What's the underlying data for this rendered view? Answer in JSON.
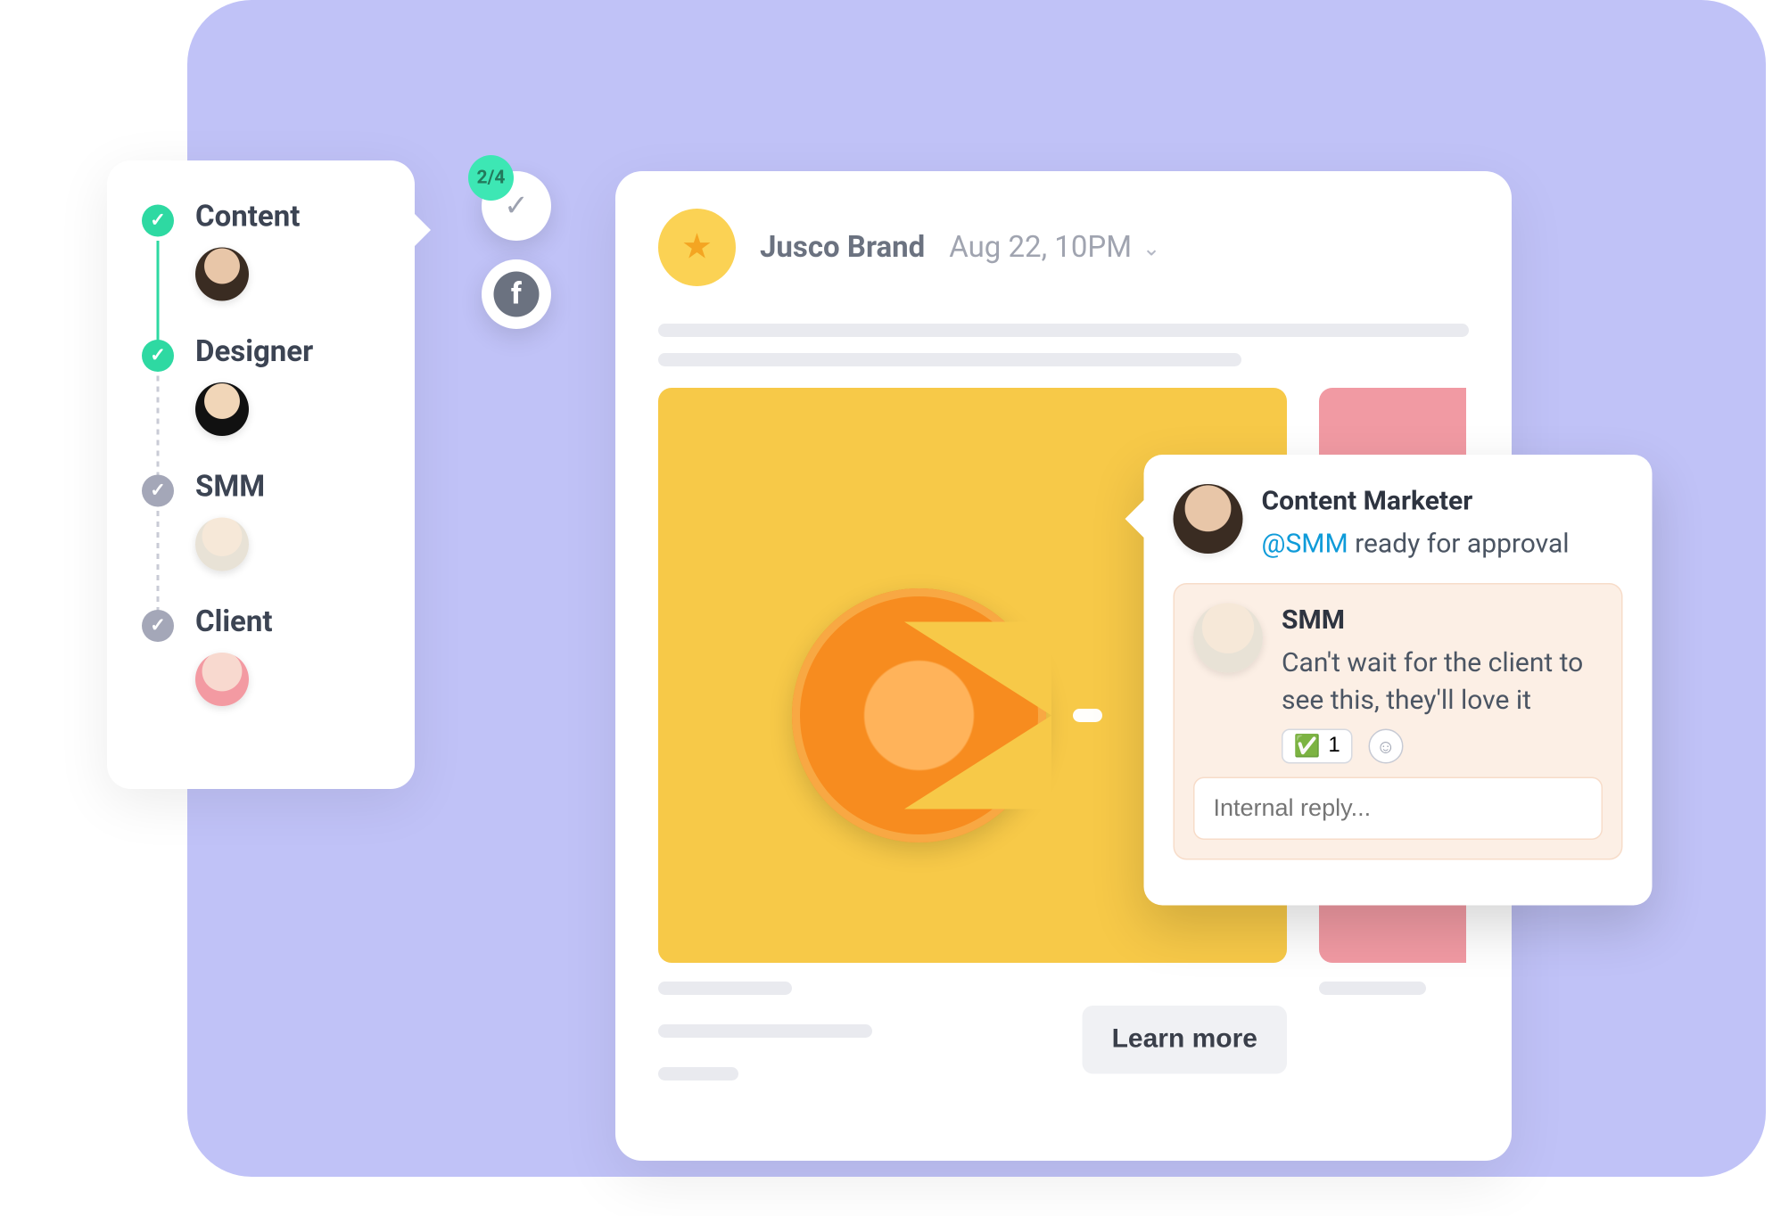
{
  "workflow": {
    "steps": [
      {
        "label": "Content",
        "done": true
      },
      {
        "label": "Designer",
        "done": true
      },
      {
        "label": "SMM",
        "done": false
      },
      {
        "label": "Client",
        "done": false
      }
    ]
  },
  "status": {
    "approval_count": "2/4",
    "platform": "facebook"
  },
  "post": {
    "brand": "Jusco Brand",
    "timestamp": "Aug 22, 10PM",
    "cta_label": "Learn more"
  },
  "comments": {
    "thread": [
      {
        "author": "Content Marketer",
        "mention": "@SMM",
        "text_after_mention": " ready for approval"
      }
    ],
    "reply": {
      "author": "SMM",
      "text": "Can't wait for the client to see this, they'll love it",
      "reaction_emoji": "✅",
      "reaction_count": "1"
    },
    "reply_placeholder": "Internal reply..."
  }
}
